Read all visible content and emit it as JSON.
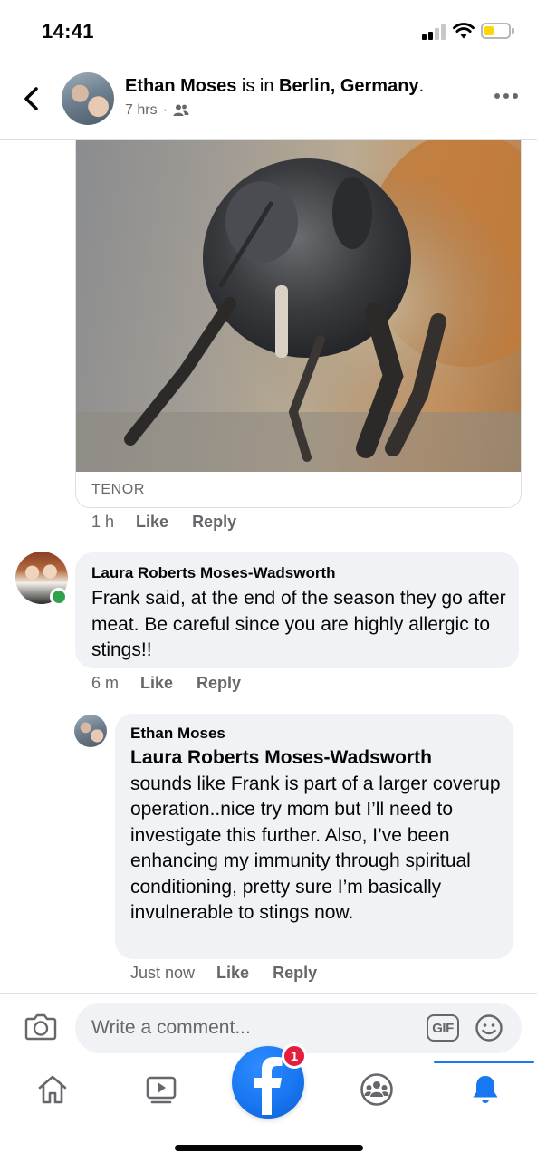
{
  "status_bar": {
    "time": "14:41",
    "icons": [
      "cellular-signal-icon",
      "wifi-icon",
      "battery-icon"
    ]
  },
  "header": {
    "author": "Ethan Moses",
    "connector": " is in ",
    "location": "Berlin, Germany",
    "period": ".",
    "timestamp": "7 hrs",
    "separator": "·",
    "audience_icon": "friends-icon",
    "back_icon": "chevron-left-icon",
    "more_icon": "more-dots-icon"
  },
  "gif_comment": {
    "source_label": "TENOR",
    "time": "1 h",
    "like_label": "Like",
    "reply_label": "Reply"
  },
  "comments": [
    {
      "author": "Laura Roberts Moses-Wadsworth",
      "text": "Frank said, at the end of the season they go after meat. Be careful since you are highly allergic to stings!!",
      "time": "6 m",
      "like_label": "Like",
      "reply_label": "Reply",
      "online": true
    },
    {
      "author": "Ethan Moses",
      "mention": "Laura Roberts Moses-Wadsworth",
      "text": "sounds like Frank is part of a larger coverup operation..nice try mom but I’ll need to investigate this further. Also, I’ve been enhancing my immunity through spiritual conditioning, pretty sure I’m basically invulnerable to stings now.",
      "time": "Just now",
      "like_label": "Like",
      "reply_label": "Reply"
    }
  ],
  "composer": {
    "placeholder": "Write a comment...",
    "gif_label": "GIF",
    "camera_icon": "camera-icon",
    "emoji_icon": "emoji-icon"
  },
  "tab_bar": {
    "tabs": [
      "home-icon",
      "video-icon",
      "facebook-logo-icon",
      "groups-icon",
      "notifications-bell-icon"
    ],
    "active_tab": "notifications-bell-icon",
    "badge_count": "1"
  },
  "colors": {
    "accent": "#1877f2",
    "bubble": "#f0f2f5",
    "secondary_text": "#65676b",
    "online": "#31a24c",
    "badge": "#e41e3f"
  }
}
